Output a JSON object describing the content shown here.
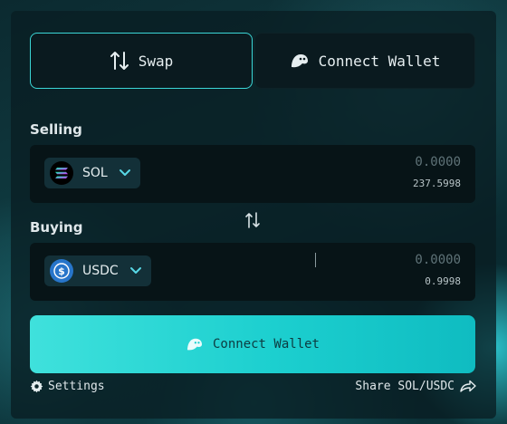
{
  "tabs": {
    "swap_label": "Swap",
    "connect_label": "Connect Wallet"
  },
  "selling": {
    "label": "Selling",
    "token": "SOL",
    "amount_placeholder": "0.0000",
    "balance": "237.5998"
  },
  "buying": {
    "label": "Buying",
    "token": "USDC",
    "amount_placeholder": "0.0000",
    "balance": "0.9998"
  },
  "cta": {
    "label": "Connect Wallet"
  },
  "footer": {
    "settings_label": "Settings",
    "share_label": "Share SOL/USDC"
  },
  "colors": {
    "accent": "#3bd6d6",
    "cta_gradient_start": "#3fe1dc",
    "cta_gradient_end": "#0fbcc1",
    "panel_bg": "#091e23",
    "usdc_blue": "#2775ca"
  },
  "icons": {
    "swap_tab": "up-down-arrows-icon",
    "wallet": "ghost-wallet-icon",
    "sol": "solana-logo-icon",
    "usdc": "usdc-logo-icon",
    "chevron": "chevron-down-icon",
    "settings": "gear-icon",
    "share": "share-arrow-icon"
  }
}
